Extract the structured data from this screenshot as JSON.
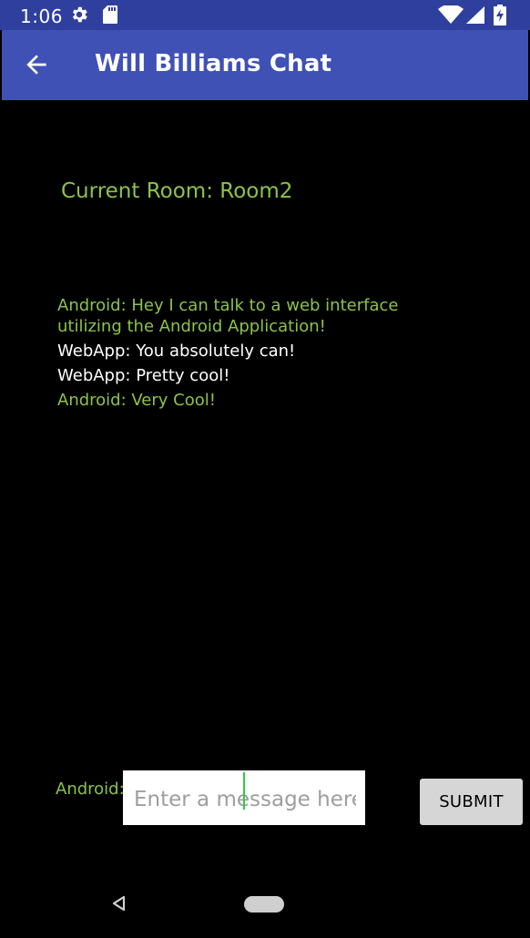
{
  "status_bar": {
    "time": "1:06",
    "icons": [
      "settings-gear-icon",
      "sd-card-icon",
      "wifi-icon",
      "cell-signal-icon",
      "battery-charging-icon"
    ],
    "background_color": "#2f3f9e"
  },
  "app_bar": {
    "title": "Will Billiams Chat",
    "back_icon": "arrow-back-icon",
    "background_color": "#3f51b5"
  },
  "room": {
    "label": "Current Room: Room2"
  },
  "messages": [
    {
      "sender": "android",
      "text": "Android: Hey I can talk to a web interface utilizing the Android Application!"
    },
    {
      "sender": "webapp",
      "text": "WebApp: You absolutely can!"
    },
    {
      "sender": "webapp",
      "text": "WebApp: Pretty cool!"
    },
    {
      "sender": "android",
      "text": "Android: Very Cool!"
    }
  ],
  "composer": {
    "user_label": "Android:",
    "placeholder": "Enter a message here",
    "value": "",
    "submit_label": "SUBMIT"
  },
  "nav_bar": {
    "icons": [
      "nav-back-icon",
      "nav-home-icon"
    ]
  },
  "colors": {
    "android_text": "#8bc34a",
    "webapp_text": "#ffffff",
    "background": "#000000",
    "cursor": "#2ecc40"
  }
}
